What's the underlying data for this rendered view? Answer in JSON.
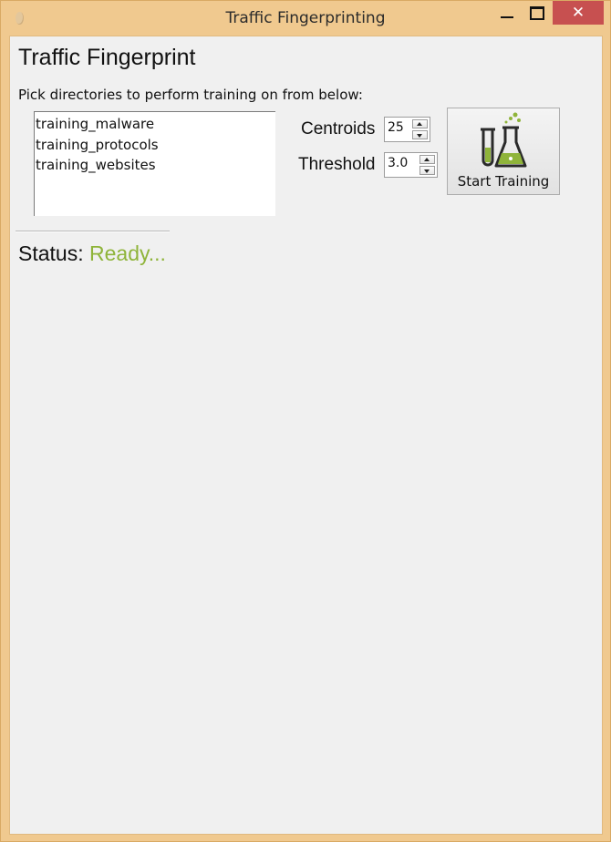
{
  "window": {
    "title": "Traffic Fingerprinting",
    "close_glyph": "✕"
  },
  "main": {
    "heading": "Traffic Fingerprint",
    "instruction": "Pick directories to perform training on from below:",
    "directories": [
      "training_malware",
      "training_protocols",
      "training_websites"
    ],
    "centroids": {
      "label": "Centroids",
      "value": "25"
    },
    "threshold": {
      "label": "Threshold",
      "value": "3.0"
    },
    "start_button": {
      "label": "Start Training",
      "icon": "flask-icon"
    },
    "status": {
      "label": "Status:",
      "value": "Ready..."
    }
  },
  "colors": {
    "window_frame": "#f0c98f",
    "close_button": "#c75050",
    "status_ready": "#8fb43a",
    "flask_liquid": "#8fb43a"
  }
}
